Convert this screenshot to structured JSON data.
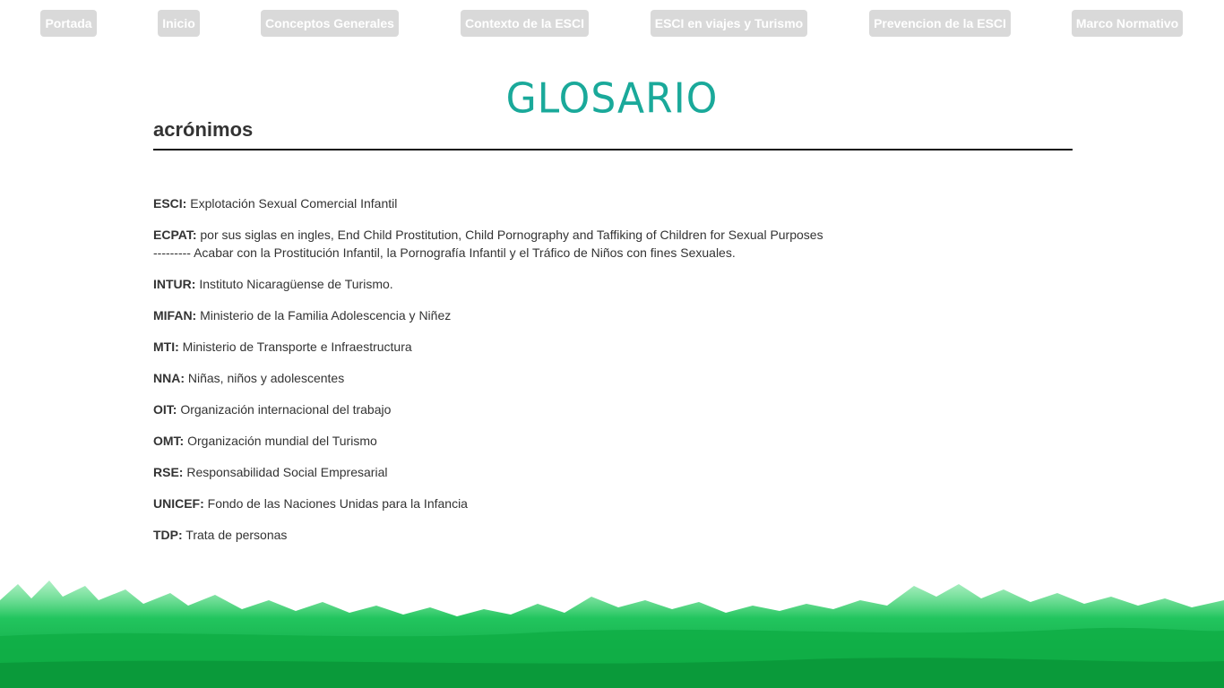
{
  "nav": {
    "items": [
      {
        "label": "Portada"
      },
      {
        "label": "Inicio"
      },
      {
        "label": "Conceptos Generales"
      },
      {
        "label": "Contexto de la ESCI"
      },
      {
        "label": "ESCI en viajes y Turismo"
      },
      {
        "label": "Prevencion de la ESCI"
      },
      {
        "label": "Marco Normativo"
      }
    ]
  },
  "page": {
    "title": "GLOSARIO"
  },
  "section": {
    "heading": "acrónimos",
    "entries": [
      {
        "abbr": "ESCI:",
        "text": " Explotación Sexual Comercial Infantil"
      },
      {
        "abbr": "ECPAT:",
        "text": " por sus siglas en ingles, End Child Prostitution, Child Pornography and Taffiking of Children for Sexual Purposes",
        "text2": "--------- Acabar con la Prostitución Infantil, la Pornografía Infantil y el Tráfico de Niños con fines Sexuales."
      },
      {
        "abbr": "INTUR:",
        "text": " Instituto Nicaragüense de Turismo."
      },
      {
        "abbr": "MIFAN:",
        "text": " Ministerio de la Familia Adolescencia y Niñez"
      },
      {
        "abbr": "MTI:",
        "text": " Ministerio de Transporte e Infraestructura"
      },
      {
        "abbr": "NNA:",
        "text": " Niñas, niños y adolescentes"
      },
      {
        "abbr": "OIT:",
        "text": " Organización internacional del trabajo"
      },
      {
        "abbr": "OMT:",
        "text": " Organización mundial del Turismo"
      },
      {
        "abbr": "RSE:",
        "text": " Responsabilidad Social Empresarial"
      },
      {
        "abbr": "UNICEF:",
        "text": " Fondo de las Naciones Unidas para la Infancia"
      },
      {
        "abbr": "TDP:",
        "text": " Trata de personas"
      }
    ]
  },
  "colors": {
    "title": "#1aa99a",
    "nav_bg": "#d9d9d9",
    "grass_light": "#22c55e",
    "grass_dark": "#0a9a3a"
  }
}
